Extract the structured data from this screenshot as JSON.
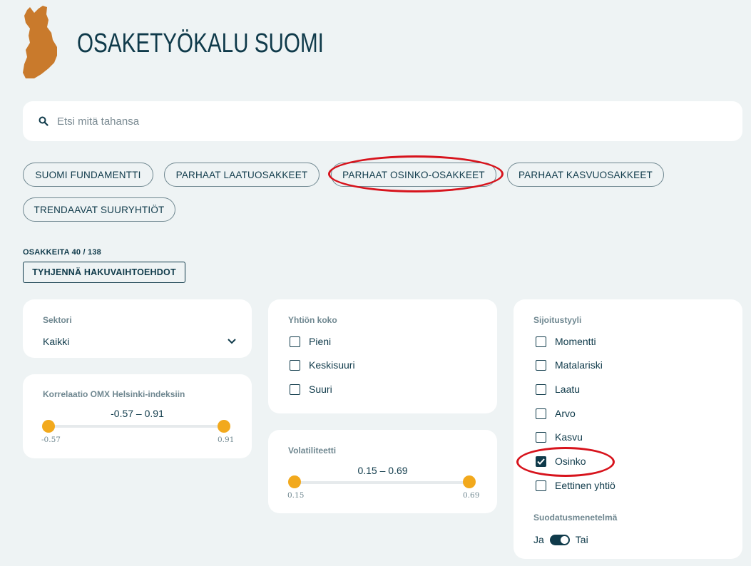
{
  "header": {
    "title": "OSAKETYÖKALU SUOMI",
    "logo_icon": "finland-map-icon",
    "logo_color": "#c97a2c"
  },
  "search": {
    "placeholder": "Etsi mitä tahansa",
    "value": "",
    "icon": "search-icon"
  },
  "presets": [
    {
      "label": "SUOMI FUNDAMENTTI"
    },
    {
      "label": "PARHAAT LAATUOSAKKEET"
    },
    {
      "label": "PARHAAT OSINKO-OSAKKEET"
    },
    {
      "label": "PARHAAT KASVUOSAKKEET"
    },
    {
      "label": "TRENDAAVAT SUURYHTIÖT"
    }
  ],
  "results": {
    "count_label": "OSAKKEITA 40 / 138",
    "clear_label": "TYHJENNÄ HAKUVAIHTOEHDOT"
  },
  "filters": {
    "sector": {
      "label": "Sektori",
      "value": "Kaikki",
      "icon": "chevron-down-icon"
    },
    "correlation": {
      "label": "Korrelaatio OMX Helsinki-indeksiin",
      "range_text": "-0.57 – 0.91",
      "min_label": "-0.57",
      "max_label": "0.91",
      "min": -0.57,
      "max": 0.91
    },
    "company_size": {
      "label": "Yhtiön koko",
      "options": [
        {
          "label": "Pieni",
          "checked": false
        },
        {
          "label": "Keskisuuri",
          "checked": false
        },
        {
          "label": "Suuri",
          "checked": false
        }
      ]
    },
    "volatility": {
      "label": "Volatiliteetti",
      "range_text": "0.15 – 0.69",
      "min_label": "0.15",
      "max_label": "0.69",
      "min": 0.15,
      "max": 0.69
    },
    "style": {
      "label": "Sijoitustyyli",
      "options": [
        {
          "label": "Momentti",
          "checked": false
        },
        {
          "label": "Matalariski",
          "checked": false
        },
        {
          "label": "Laatu",
          "checked": false
        },
        {
          "label": "Arvo",
          "checked": false
        },
        {
          "label": "Kasvu",
          "checked": false
        },
        {
          "label": "Osinko",
          "checked": true
        },
        {
          "label": "Eettinen yhtiö",
          "checked": false
        }
      ]
    },
    "method": {
      "label": "Suodatusmenetelmä",
      "left": "Ja",
      "right": "Tai",
      "value": "Tai"
    }
  },
  "colors": {
    "background": "#eef3f4",
    "text": "#0f3a4a",
    "accent": "#f2a91d",
    "highlight": "#d7131c"
  }
}
